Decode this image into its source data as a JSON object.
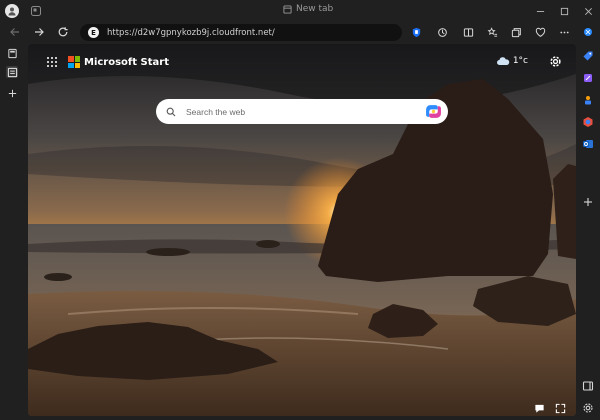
{
  "browser": {
    "tab_title": "New tab",
    "url": "https://d2w7gpnykozb9j.cloudfront.net/",
    "site_badge": "E"
  },
  "page": {
    "brand_name": "Microsoft Start",
    "weather_temp": "1°c",
    "search_placeholder": "Search the web"
  },
  "icons": {
    "left_rail": [
      "tab-actions-icon",
      "vertical-tabs-icon",
      "new-tab-plus-icon"
    ],
    "right_rail": [
      "copilot-icon",
      "shopping-tag-icon",
      "tools-icon",
      "games-icon",
      "microsoft-365-icon",
      "outlook-icon",
      "add-icon",
      "sidebar-toggle-icon",
      "settings-icon"
    ]
  },
  "colors": {
    "accent": "#0078d4",
    "ms_red": "#f25022",
    "ms_green": "#7fba00",
    "ms_blue": "#00a4ef",
    "ms_yellow": "#ffb900"
  }
}
